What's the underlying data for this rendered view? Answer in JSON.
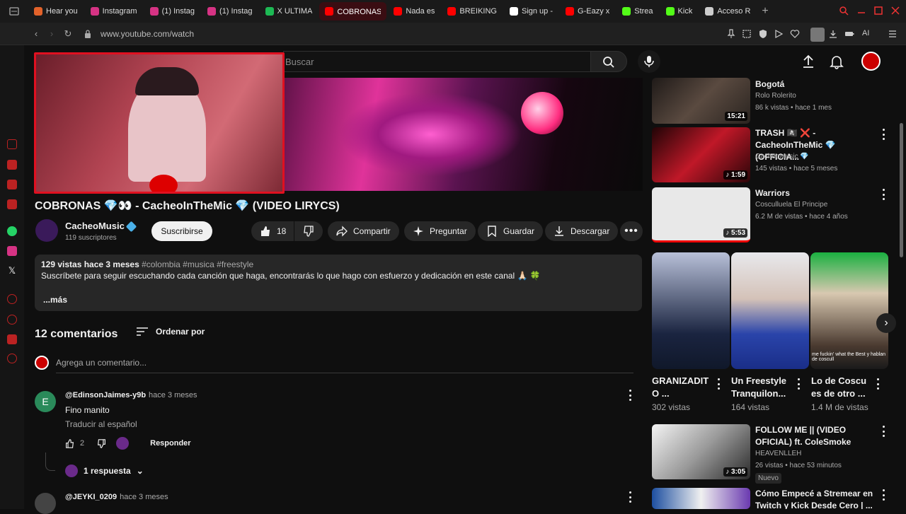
{
  "browser": {
    "tabs": [
      {
        "label": "Hear you",
        "color": "#e2622a"
      },
      {
        "label": "Instagram",
        "color": "#d63384"
      },
      {
        "label": "(1) Instag",
        "color": "#d63384"
      },
      {
        "label": "(1) Instag",
        "color": "#d63384"
      },
      {
        "label": "X ULTIMA",
        "color": "#1db954"
      },
      {
        "label": "COBRONAS 💎👀",
        "color": "#ff0000",
        "active": true
      },
      {
        "label": "Nada es",
        "color": "#ff0000"
      },
      {
        "label": "BREIKING",
        "color": "#ff0000"
      },
      {
        "label": "Sign up -",
        "color": "#ffffff"
      },
      {
        "label": "G-Eazy x",
        "color": "#ff0000"
      },
      {
        "label": "Strea",
        "color": "#53fc18"
      },
      {
        "label": "Kick",
        "color": "#53fc18"
      },
      {
        "label": "Acceso R",
        "color": "#cccccc"
      }
    ],
    "url": "www.youtube.com/watch",
    "ai_label": "AI"
  },
  "youtube": {
    "search_placeholder": "Buscar",
    "video_title": "COBRONAS 💎👀 - CacheoInTheMic 💎 (VIDEO LIRYCS)",
    "channel_name": "CacheoMusic",
    "subscribers": "119 suscriptores",
    "subscribe_label": "Suscribirse",
    "likes": "18",
    "share_label": "Compartir",
    "ask_label": "Preguntar",
    "save_label": "Guardar",
    "download_label": "Descargar",
    "description": {
      "views_time": "129 vistas  hace 3 meses",
      "tags": "#colombia #musica #freestyle",
      "text": "Suscríbete para seguir escuchando cada canción que haga, encontrarás lo que hago con esfuerzo y dedicación en este canal 🙏🏻 🍀",
      "more": "...más"
    },
    "comments": {
      "count_label": "12 comentarios",
      "sort_label": "Ordenar por",
      "add_placeholder": "Agrega un comentario...",
      "items": [
        {
          "initial": "E",
          "user": "@EdinsonJaimes-y9b",
          "time": "hace 3 meses",
          "text": "Fino manito",
          "translate": "Traducir al español",
          "likes": "2",
          "reply": "Responder"
        },
        {
          "user": "@JEYKI_0209",
          "time": "hace 3 meses"
        }
      ],
      "replies_label": "1 respuesta"
    },
    "recommendations": [
      {
        "title": "Bogotá",
        "channel": "Rolo Rolerito",
        "stats": "86 k vistas • hace 1 mes",
        "duration": "15:21",
        "thumb": "#3a3a3a"
      },
      {
        "title": "TRASH 🏴‍☠️ ❌ - CacheoInTheMic 💎 (OFFICIA...",
        "channel": "CacheoMusic 💎",
        "stats": "145 vistas • hace 5 meses",
        "duration": "1:59",
        "thumb": "#8a1020"
      },
      {
        "title": "Warriors",
        "channel": "Cosculluela El Principe",
        "stats": "6.2 M de vistas • hace 4 años",
        "duration": "5:53",
        "thumb": "#dddddd"
      },
      {
        "title": "FOLLOW ME || (VIDEO OFICIAL) ft. ColeSmoke",
        "channel": "HEAVENLLEH",
        "stats": "26 vistas • hace 53 minutos",
        "duration": "3:05",
        "badge": "Nuevo",
        "thumb": "#bbbbbb"
      },
      {
        "title": "Cómo Empecé a Stremear en Twitch y Kick Desde Cero | ...",
        "thumb": "#1d4fa0"
      }
    ],
    "shorts": [
      {
        "title": "GRANIZADIT O ...",
        "views": "302 vistas",
        "thumb": "#2a3a5a"
      },
      {
        "title": "Un Freestyle Tranquilon...",
        "views": "164 vistas",
        "thumb": "#3355aa"
      },
      {
        "title": "Lo de Coscu es de otro ...",
        "views": "1.4 M de vistas",
        "thumb": "#1a8a30",
        "caption": "me fuckin' what the Best y hablan de coscull"
      }
    ]
  }
}
